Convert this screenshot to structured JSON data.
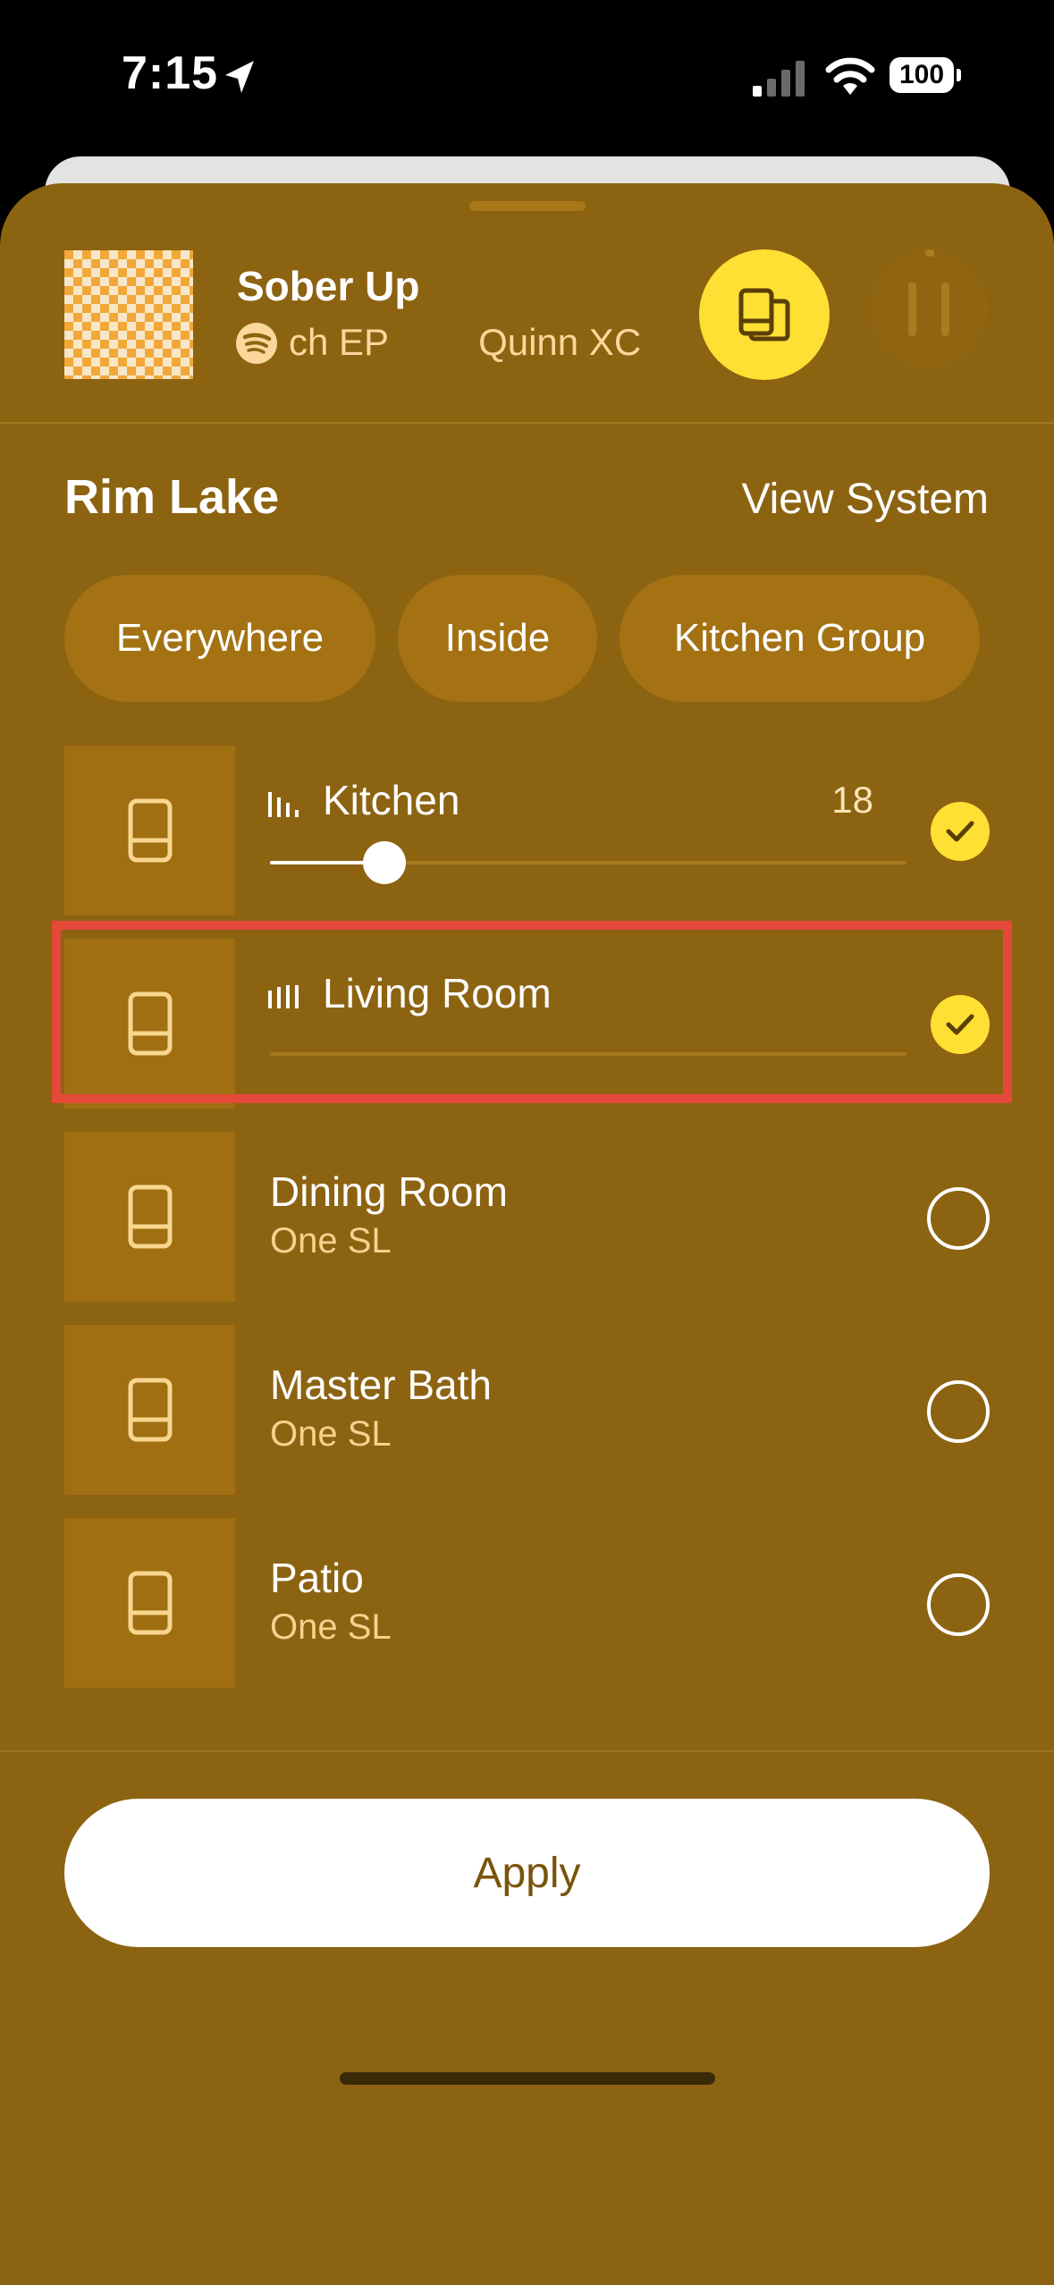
{
  "status_bar": {
    "time": "7:15",
    "battery": "100"
  },
  "now_playing": {
    "title": "Sober Up",
    "album": "ch EP",
    "artist": "Quinn XC",
    "group_icon": "speaker-group-icon",
    "pause_icon": "pause-icon"
  },
  "system": {
    "name": "Rim Lake",
    "view_system_label": "View System"
  },
  "groups": [
    {
      "label": "Everywhere"
    },
    {
      "label": "Inside"
    },
    {
      "label": "Kitchen Group"
    }
  ],
  "rooms": [
    {
      "name": "Kitchen",
      "volume": "18",
      "volume_level": 0.18,
      "selected": true,
      "playing": true
    },
    {
      "name": "Living Room",
      "selected": true,
      "playing": true
    },
    {
      "name": "Dining Room",
      "model": "One SL",
      "selected": false
    },
    {
      "name": "Master Bath",
      "model": "One SL",
      "selected": false
    },
    {
      "name": "Patio",
      "model": "One SL",
      "selected": false
    }
  ],
  "apply_label": "Apply",
  "colors": {
    "sheet": "#8c6311",
    "accent_yellow": "#fde033",
    "highlight": "#e5493a"
  }
}
